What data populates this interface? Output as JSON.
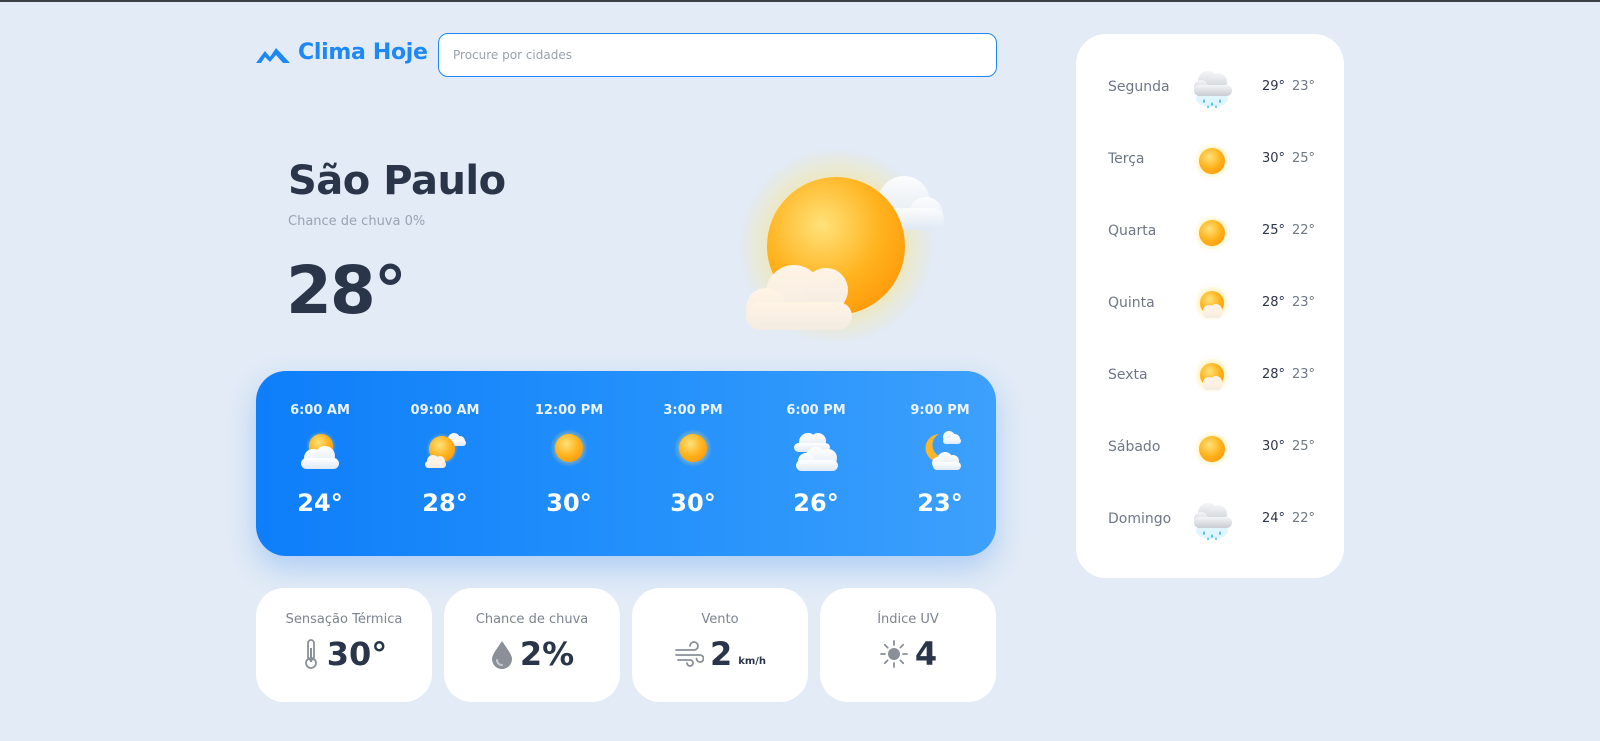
{
  "app": {
    "name": "Clima Hoje",
    "search_placeholder": "Procure por cidades",
    "brand_color": "#1e88f5"
  },
  "current": {
    "city": "São Paulo",
    "rain_chance": "Chance de chuva 0%",
    "temperature": "28°",
    "icon": "sun-cloud-icon"
  },
  "hourly": [
    {
      "time": "6:00 AM",
      "temp": "24°",
      "icon": "sun-behind-cloud-icon"
    },
    {
      "time": "09:00 AM",
      "temp": "28°",
      "icon": "partly-sunny-icon"
    },
    {
      "time": "12:00 PM",
      "temp": "30°",
      "icon": "sun-icon"
    },
    {
      "time": "3:00 PM",
      "temp": "30°",
      "icon": "sun-icon"
    },
    {
      "time": "6:00 PM",
      "temp": "26°",
      "icon": "cloud-icon"
    },
    {
      "time": "9:00 PM",
      "temp": "23°",
      "icon": "moon-cloud-icon"
    }
  ],
  "stats": [
    {
      "label": "Sensação Térmica",
      "value": "30°",
      "unit": "",
      "icon": "thermometer-icon"
    },
    {
      "label": "Chance de chuva",
      "value": "2%",
      "unit": "",
      "icon": "raindrop-icon"
    },
    {
      "label": "Vento",
      "value": "2",
      "unit": "km/h",
      "icon": "wind-icon"
    },
    {
      "label": "Índice UV",
      "value": "4",
      "unit": "",
      "icon": "uv-sun-icon"
    }
  ],
  "weekly": [
    {
      "day": "Segunda",
      "max": "29°",
      "min": "23°",
      "icon": "rain-cloud-icon"
    },
    {
      "day": "Terça",
      "max": "30°",
      "min": "25°",
      "icon": "sun-icon"
    },
    {
      "day": "Quarta",
      "max": "25°",
      "min": "22°",
      "icon": "sun-icon"
    },
    {
      "day": "Quinta",
      "max": "28°",
      "min": "23°",
      "icon": "sun-behind-cloud-icon"
    },
    {
      "day": "Sexta",
      "max": "28°",
      "min": "23°",
      "icon": "sun-behind-cloud-icon"
    },
    {
      "day": "Sábado",
      "max": "30°",
      "min": "25°",
      "icon": "sun-icon"
    },
    {
      "day": "Domingo",
      "max": "24°",
      "min": "22°",
      "icon": "rain-cloud-icon"
    }
  ]
}
